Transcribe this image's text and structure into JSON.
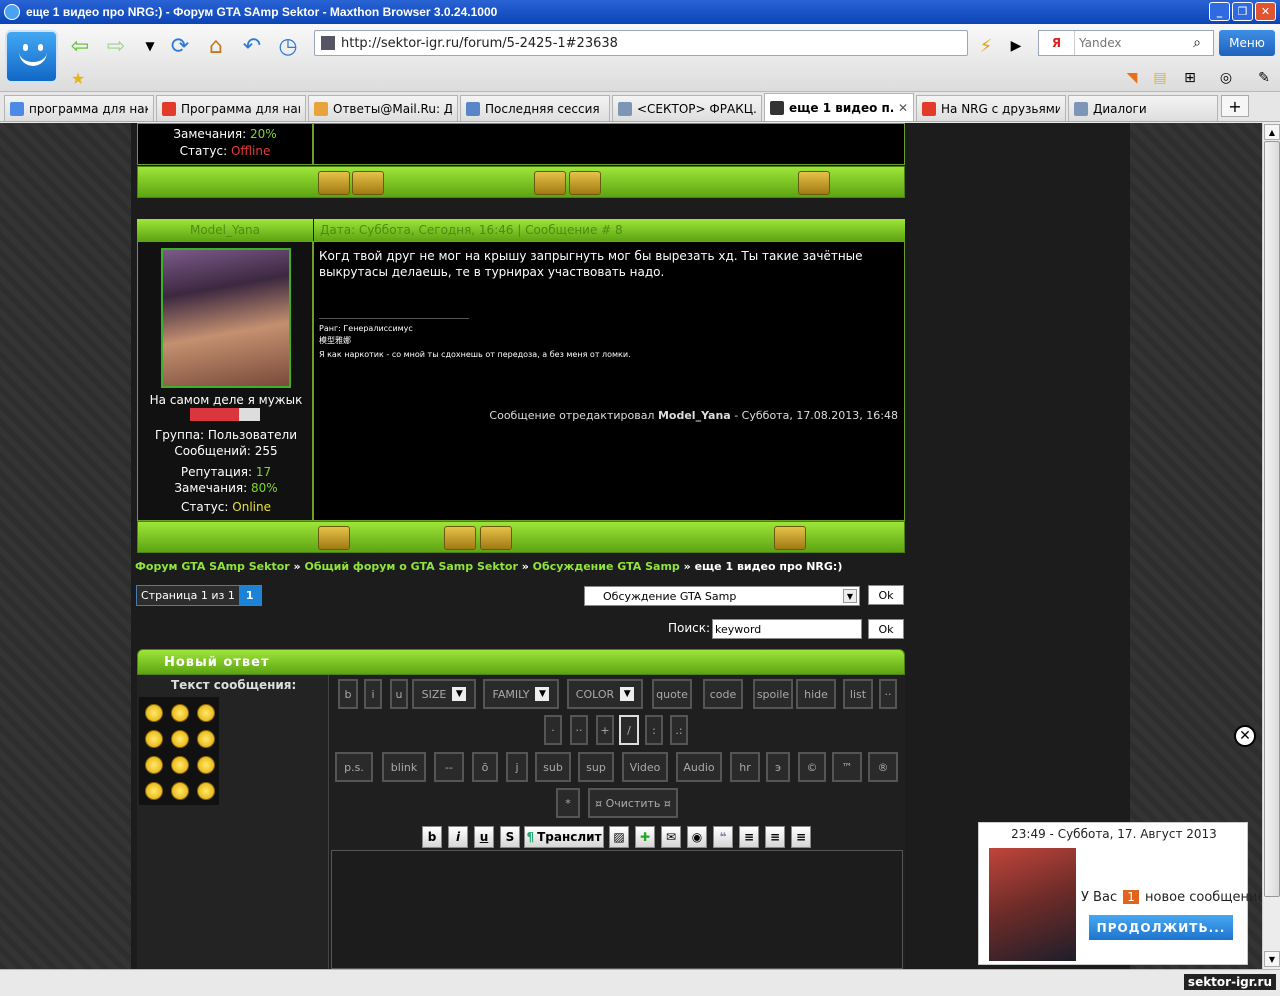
{
  "window": {
    "title": "еще 1 видео про NRG:) - Форум GTA SAmp Sektor - Maxthon Browser 3.0.24.1000"
  },
  "toolbar": {
    "url": "http://sektor-igr.ru/forum/5-2425-1#23638",
    "search_placeholder": "Yandex",
    "menu_label": "Меню"
  },
  "tabs": [
    {
      "label": "программа для нак...",
      "color": "#4d8ae6"
    },
    {
      "label": "Программа для нак...",
      "color": "#e23b2a"
    },
    {
      "label": "Ответы@Mail.Ru: Дв...",
      "color": "#e8a33a"
    },
    {
      "label": "Последняя сессия",
      "color": "#5a86c9"
    },
    {
      "label": "<СЕКТОР> ФРАКЦ...",
      "color": "#7d95b7"
    },
    {
      "label": "еще 1 видео п...",
      "color": "#e23b2a"
    },
    {
      "label": "На NRG с друзьями ...",
      "color": "#e23b2a"
    },
    {
      "label": "Диалоги",
      "color": "#7d95b7"
    }
  ],
  "prev_post": {
    "remarks_label": "Замечания:",
    "remarks_value": "20%",
    "status_label": "Статус:",
    "status_value": "Offline"
  },
  "post": {
    "author": "Model_Yana",
    "header": "Дата: Суббота, Сегодня, 16:46 | Сообщение # 8",
    "text": "Когд твой друг не мог на крышу запрыгнуть мог бы вырезать хд. Ты такие зачётные выкрутасы делаешь, те в турнирах участвовать надо.",
    "sig_rank": "Ранг: Генералиссимус",
    "sig_line2": "模型雅娜",
    "sig_line3": "Я как наркотик - со мной ты сдохнешь от передоза, а без меня от ломки.",
    "edited_prefix": "Сообщение отредактировал",
    "edited_name": "Model_Yana",
    "edited_suffix": "- Суббота, 17.08.2013, 16:48",
    "user_title": "На самом деле я мужык",
    "rating": 0.7,
    "group": "Группа: Пользователи",
    "messages": "Сообщений: 255",
    "rep_label": "Репутация:",
    "rep_value": "17",
    "remarks_label": "Замечания:",
    "remarks_value": "80%",
    "status_label": "Статус:",
    "status_value": "Online"
  },
  "breadcrumb": {
    "c1": "Форум GTA SAmp Sektor",
    "c2": "Общий форум о GTA Samp Sektor",
    "c3": "Обсуждение GTA Samp",
    "current": "еще 1 видео про NRG:)",
    "sep": " » "
  },
  "pager": {
    "label": "Страница 1 из 1",
    "current": "1"
  },
  "jump": {
    "selected": "Обсуждение GTA Samp",
    "ok": "Ok"
  },
  "forum_search": {
    "label": "Поиск:",
    "value": "keyword",
    "ok": "Ok"
  },
  "reply": {
    "title": "Новый ответ",
    "text_label": "Текст сообщения:",
    "buttons_row1": [
      "b",
      "i",
      "u"
    ],
    "size_label": "SIZE",
    "family_label": "FAMILY",
    "color_label": "COLOR",
    "buttons_row1b": [
      "quote",
      "code",
      "spoile",
      "hide",
      "list",
      "··"
    ],
    "buttons_row2": [
      "·",
      "··",
      "+",
      "/",
      ":",
      ".:"
    ],
    "buttons_row3": [
      "p.s.",
      "blink",
      "--",
      "ō",
      "j",
      "sub",
      "sup",
      "Video",
      "Audio",
      "hr",
      "э",
      "©",
      "™",
      "®"
    ],
    "buttons_row4": [
      "*",
      "¤ Очистить ¤"
    ],
    "fmt_b": "b",
    "fmt_i": "i",
    "fmt_u": "u",
    "fmt_s": "S",
    "translit": "Транслит"
  },
  "popup": {
    "time": "23:49 - Суббота, 17. Август 2013",
    "text_pre": "У Вас",
    "count": "1",
    "text_post": "новое сообщение",
    "button": "ПРОДОЛЖИТЬ..."
  },
  "status": {
    "site": "sektor-igr.ru"
  },
  "colors": {
    "accent_green": "#7fd82a",
    "offline": "#e53b3b",
    "online": "#e8e13a"
  }
}
